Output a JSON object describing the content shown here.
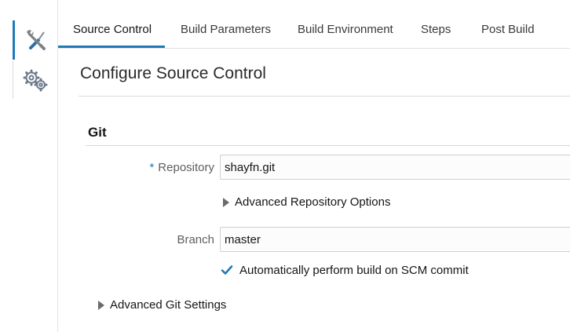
{
  "tabs": [
    {
      "label": "Source Control",
      "active": true
    },
    {
      "label": "Build Parameters",
      "active": false
    },
    {
      "label": "Build Environment",
      "active": false
    },
    {
      "label": "Steps",
      "active": false
    },
    {
      "label": "Post Build",
      "active": false
    }
  ],
  "sidebar": {
    "items": [
      {
        "icon": "tools-icon",
        "active": true
      },
      {
        "icon": "gears-icon",
        "active": false
      }
    ]
  },
  "page": {
    "title": "Configure Source Control"
  },
  "git": {
    "section_title": "Git",
    "repository": {
      "required_mark": "*",
      "label": "Repository",
      "value": "shayfn.git"
    },
    "advanced_repo_options": "Advanced Repository Options",
    "branch": {
      "label": "Branch",
      "value": "master"
    },
    "auto_build": {
      "label": "Automatically perform build on SCM commit",
      "checked": true
    },
    "advanced_git_settings": "Advanced Git Settings"
  },
  "colors": {
    "accent": "#1f7ab8",
    "text": "#161513",
    "muted_label": "#5f5f5f"
  }
}
